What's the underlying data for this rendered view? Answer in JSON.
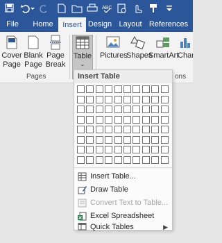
{
  "ribbon_tabs": [
    "File",
    "Home",
    "Insert",
    "Design",
    "Layout",
    "References"
  ],
  "active_tab": "Insert",
  "ribbon": {
    "cover_page": "Cover\nPage",
    "blank_page": "Blank\nPage",
    "page_break": "Page\nBreak",
    "pages_group": "Pages",
    "table": "Table",
    "pictures": "Pictures",
    "shapes": "Shapes",
    "smartart": "SmartArt",
    "chart": "Char",
    "trailing_group": "ons"
  },
  "dropdown": {
    "header": "Insert Table",
    "grid": {
      "columns": 10,
      "rows": 8
    },
    "items": [
      {
        "label": "Insert Table...",
        "icon": "insert-table-icon",
        "enabled": true,
        "submenu": false
      },
      {
        "label": "Draw Table",
        "icon": "draw-table-icon",
        "enabled": true,
        "submenu": false
      },
      {
        "label": "Convert Text to Table...",
        "icon": "convert-text-icon",
        "enabled": false,
        "submenu": false
      },
      {
        "label": "Excel Spreadsheet",
        "icon": "excel-icon",
        "enabled": true,
        "submenu": false
      },
      {
        "label": "Quick Tables",
        "icon": "quick-tables-icon",
        "enabled": true,
        "submenu": true
      }
    ],
    "submenu_arrow": "▶"
  },
  "colors": {
    "ribbon_blue": "#2b579a",
    "excel_green": "#217346",
    "ribbon_bg": "#f3f3f3"
  }
}
